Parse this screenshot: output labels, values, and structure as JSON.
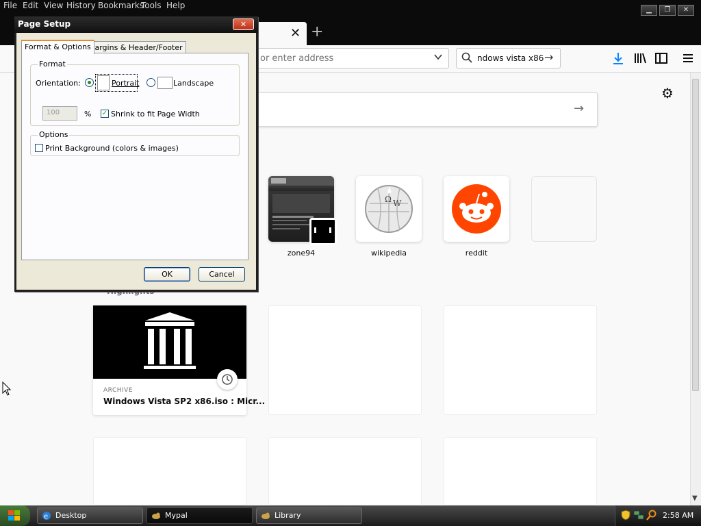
{
  "menubar": {
    "items": [
      "File",
      "Edit",
      "View",
      "History",
      "Bookmarks",
      "Tools",
      "Help"
    ]
  },
  "tabs": {
    "close_symbol": "✕",
    "new_tab_symbol": "+"
  },
  "toolbar": {
    "url_placeholder": "or enter address",
    "search_value": "ndows vista x86",
    "search_go": "→"
  },
  "newtab": {
    "search_go": "→",
    "top_sites": [
      {
        "label": "zone94"
      },
      {
        "label": "wikipedia"
      },
      {
        "label": "reddit"
      },
      {
        "label": ""
      }
    ],
    "highlights_title": "Highlights",
    "highlights": [
      {
        "source": "ARCHIVE",
        "title": "Windows Vista SP2 x86.iso : Micr..."
      }
    ]
  },
  "dialog": {
    "title": "Page Setup",
    "close_symbol": "✕",
    "tabs": [
      "Format & Options",
      "Margins & Header/Footer"
    ],
    "format_group": "Format",
    "orientation_label": "Orientation:",
    "portrait_label": "Portrait",
    "landscape_label": "Landscape",
    "scale_value": "100",
    "percent_sign": "%",
    "shrink_label": "Shrink to fit Page Width",
    "shrink_checked": true,
    "options_group": "Options",
    "print_background_label": "Print Background (colors & images)",
    "print_background_checked": false,
    "ok_label": "OK",
    "cancel_label": "Cancel"
  },
  "taskbar": {
    "tasks": [
      "Desktop",
      "Mypal",
      "Library"
    ],
    "clock": "2:58 AM"
  },
  "colors": {
    "accent_blue": "#0a84ff",
    "reddit_orange": "#ff4500",
    "dialog_tab_highlight": "#e68b2c"
  }
}
